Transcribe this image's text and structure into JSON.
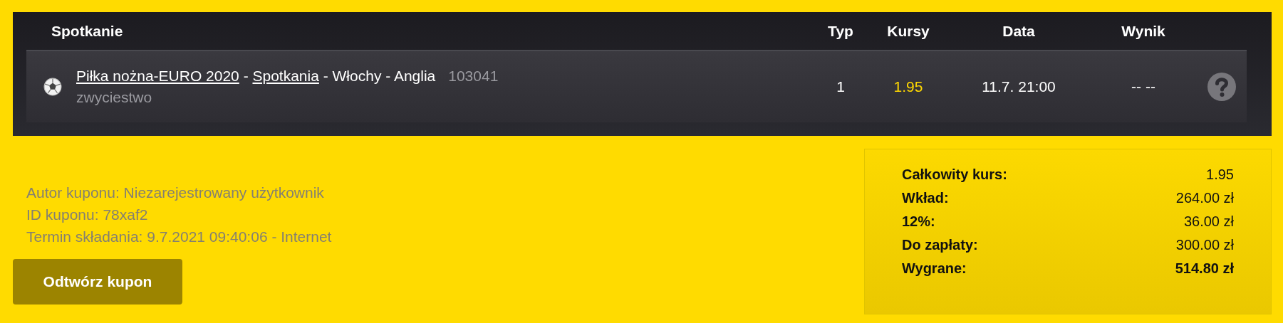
{
  "table": {
    "columns": [
      "Spotkanie",
      "Typ",
      "Kursy",
      "Data",
      "Wynik"
    ],
    "rows": [
      {
        "sport_link": "Piłka nożna-EURO 2020",
        "separator_1": " - ",
        "stage_link": "Spotkania",
        "teams": " - Włochy - Anglia",
        "event_id": "103041",
        "market": "zwyciestwo",
        "type": "1",
        "odds": "1.95",
        "date": "11.7. 21:00",
        "result": "-- --"
      }
    ]
  },
  "coupon_info": [
    "Autor kuponu: Niezarejestrowany użytkownik",
    "ID kuponu: 78xaf2",
    "Termin składania: 9.7.2021 09:40:06 - Internet"
  ],
  "restore_button": "Odtwórz kupon",
  "summary": [
    {
      "label": "Całkowity kurs:",
      "value": "1.95",
      "emphasis": false
    },
    {
      "label": "Wkład:",
      "value": "264.00 zł",
      "emphasis": false
    },
    {
      "label": "12%:",
      "value": "36.00 zł",
      "emphasis": false
    },
    {
      "label": "Do zapłaty:",
      "value": "300.00 zł",
      "emphasis": false
    },
    {
      "label": "Wygrane:",
      "value": "514.80 zł",
      "emphasis": true
    }
  ]
}
